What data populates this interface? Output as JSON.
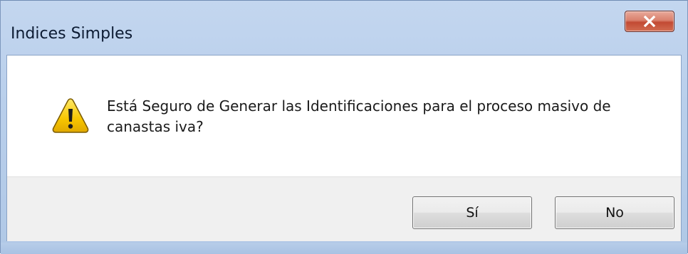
{
  "dialog": {
    "title": "Indices Simples",
    "message": "Está Seguro de Generar las Identificaciones para el proceso masivo de canastas iva?",
    "icon": "warning-icon",
    "buttons": {
      "yes_label": "Sí",
      "no_label": "No"
    }
  },
  "colors": {
    "close_button": "#c24a33",
    "frame": "#b9cfeb",
    "warning_fill": "#f5c400"
  }
}
